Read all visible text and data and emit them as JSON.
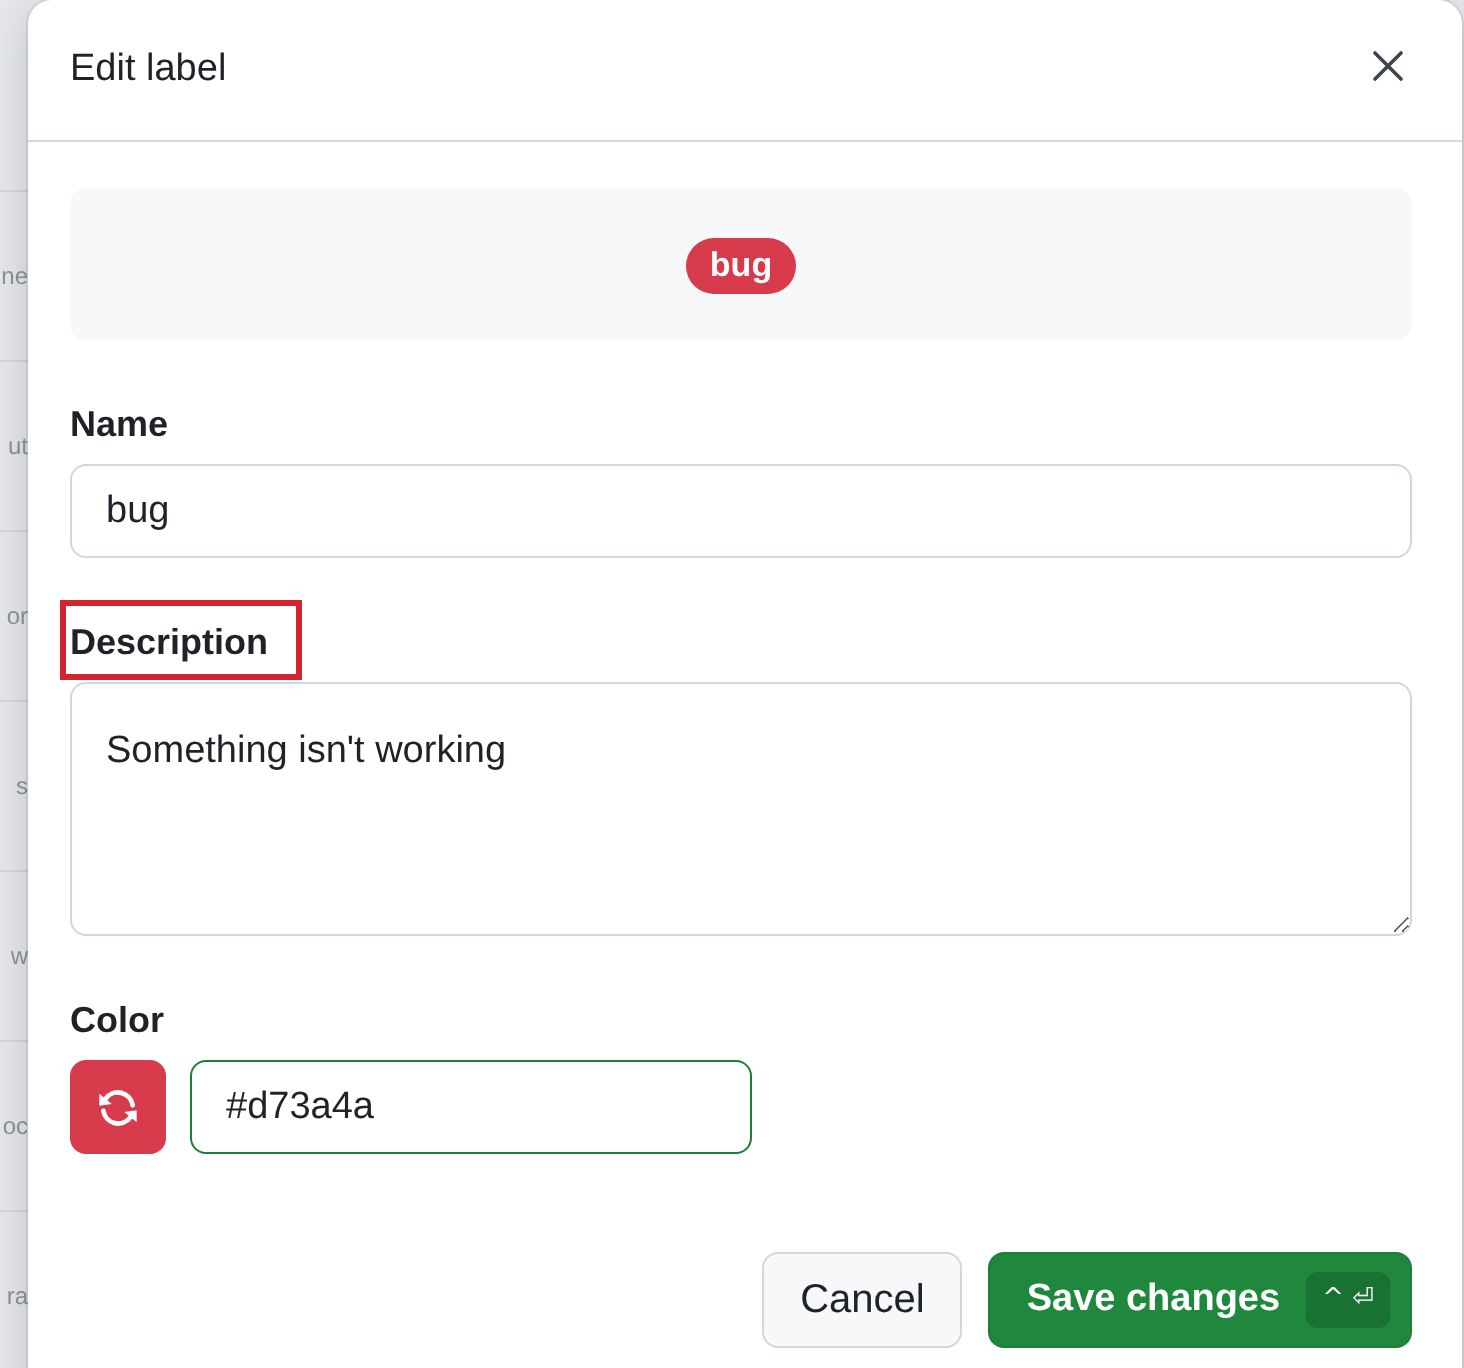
{
  "background_list": {
    "items": [
      "ne",
      "ut",
      "or",
      "s",
      "w",
      "oc",
      "ra"
    ]
  },
  "dialog": {
    "title": "Edit label"
  },
  "preview": {
    "label": {
      "text": "bug",
      "color": "#d73a4a"
    }
  },
  "fields": [
    {
      "kind": "input",
      "label": "Name",
      "value": "bug",
      "highlighted": false,
      "focused": false
    },
    {
      "kind": "textarea",
      "label": "Description",
      "value": "Something isn't working",
      "highlighted": true,
      "focused": false
    },
    {
      "kind": "color",
      "label": "Color",
      "value": "#d73a4a",
      "color": "#d73a4a",
      "highlighted": false,
      "focused": true
    }
  ],
  "buttons": [
    {
      "kind": "secondary",
      "label": "Cancel"
    },
    {
      "kind": "primary",
      "label": "Save changes",
      "shortcut": "^ ⏎"
    }
  ]
}
